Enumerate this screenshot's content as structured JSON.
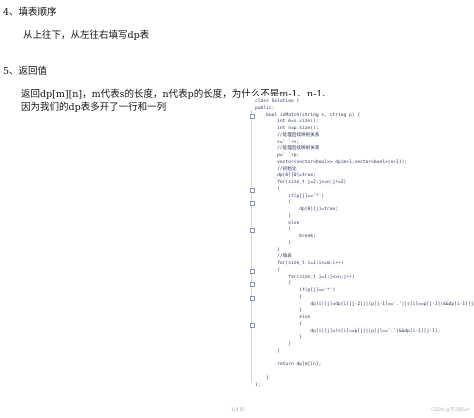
{
  "sections": [
    {
      "heading": "4、填表顺序",
      "lines": [
        "从上往下，从左往右填写dp表"
      ]
    },
    {
      "heading": "5、返回值",
      "lines": [
        "返回dp[m][n]，m代表s的长度，n代表p的长度，为什么不是m-1、n-1、",
        "因为我们的dp表多开了一行和一列"
      ]
    }
  ],
  "code": [
    "class Solution {",
    "public:",
    "    bool isMatch(string s, string p) {",
    "        int m=s.size();",
    "        int n=p.size();",
    "        //处理后续映射关系",
    "        s=' '+s;",
    "        //处理后续映射关系",
    "        p=' '+p;",
    "        vector<vector<bool>> dp(m+1,vector<bool>(n+1));",
    "        //初始化",
    "        dp[0][0]=true;",
    "        for(size_t j=2;j<=n;j+=2)",
    "        {",
    "            if(p[j]=='*')",
    "            {",
    "                dp[0][j]=true;",
    "            }",
    "            else",
    "            {",
    "                break;",
    "            }",
    "        }",
    "        //填表",
    "        for(size_t i=1;i<=m;i++)",
    "        {",
    "            for(size_t j=1;j<=n;j++)",
    "            {",
    "                if(p[j]=='*')",
    "                {",
    "                    dp[i][j]=dp[i][j-2]||(p[j-1]=='.'||s[i]==p[j-1])&&dp[i-1][j];",
    "                }",
    "                else",
    "                {",
    "                    dp[i][j]=(s[i]==p[j]||p[j]=='.')&&dp[i-1][j-1];",
    "                }",
    "            }",
    "        }",
    "",
    "        return dp[m][n];",
    "",
    "    }",
    "};"
  ],
  "footer": {
    "page_indicator": "1/4 页",
    "watermark": "CSDN @学习的Lin"
  }
}
